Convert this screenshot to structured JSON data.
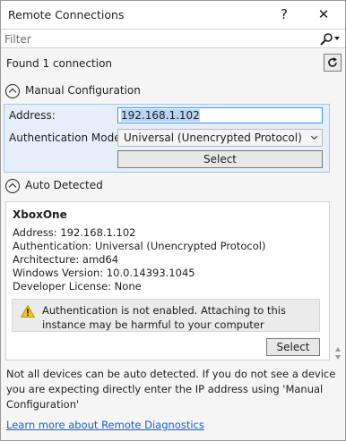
{
  "window": {
    "title": "Remote Connections",
    "help_glyph": "?",
    "close_glyph": "✕"
  },
  "filter": {
    "placeholder": "Filter",
    "icon": "search-icon"
  },
  "status": {
    "text": "Found 1 connection",
    "refresh_icon": "refresh-icon"
  },
  "manual": {
    "header": "Manual Configuration",
    "address_label": "Address:",
    "address_value": "192.168.1.102",
    "auth_label": "Authentication Mode:",
    "auth_value": "Universal (Unencrypted Protocol)",
    "select_label": "Select"
  },
  "auto": {
    "header": "Auto Detected",
    "device": {
      "name": "XboxOne",
      "address": "Address:  192.168.1.102",
      "authentication": "Authentication:  Universal (Unencrypted Protocol)",
      "architecture": "Architecture:  amd64",
      "windows_version": "Windows Version:  10.0.14393.1045",
      "developer_license": "Developer License:  None"
    },
    "warning": "Authentication is not enabled. Attaching to this instance may be harmful to your computer",
    "select_label": "Select"
  },
  "footer": {
    "note": "Not all devices can be auto detected. If you do not see a device you are expecting directly enter the IP address using 'Manual Configuration'",
    "link": "Learn more about Remote Diagnostics"
  },
  "colors": {
    "panel_bg": "#e6eefa",
    "panel_border": "#a9c6ec",
    "selection": "#b7d6f6",
    "focus_border": "#3399ff",
    "link": "#1a5ec4",
    "warning_icon": "#f3c316"
  }
}
